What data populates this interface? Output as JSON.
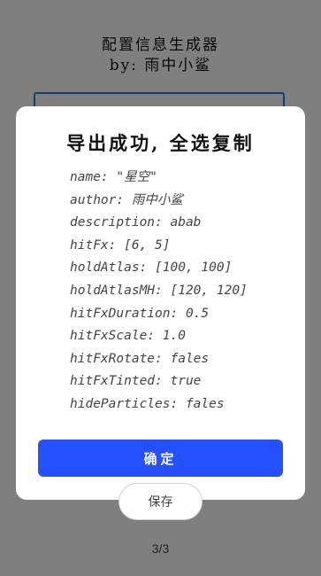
{
  "app": {
    "title_line1": "配置信息生成器",
    "title_line2": "by: 雨中小鲨"
  },
  "page": {
    "save_label": "保存",
    "pagination": "3/3"
  },
  "dialog": {
    "title": "导出成功, 全选复制",
    "lines": [
      "name: \"星空\"",
      "author: 雨中小鲨",
      "description: abab",
      "hitFx: [6, 5]",
      "holdAtlas: [100, 100]",
      "holdAtlasMH: [120, 120]",
      "hitFxDuration: 0.5",
      "hitFxScale: 1.0",
      "hitFxRotate: fales",
      "hitFxTinted: true",
      "hideParticles: fales"
    ],
    "confirm_label": "确定"
  },
  "colors": {
    "confirm_button": "#2450ff",
    "input_border": "#3d7bd6"
  }
}
